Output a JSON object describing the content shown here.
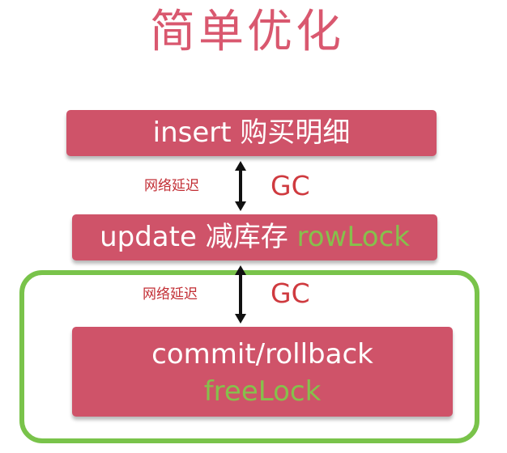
{
  "title": "简单优化",
  "steps": {
    "insert": {
      "text": "insert 购买明细"
    },
    "update": {
      "text": "update 减库存",
      "lock": "rowLock"
    },
    "commit": {
      "text": "commit/rollback",
      "lock": "freeLock"
    }
  },
  "gaps": [
    {
      "label": "网络延迟",
      "gc": "GC"
    },
    {
      "label": "网络延迟",
      "gc": "GC"
    }
  ],
  "colors": {
    "title": "#d9586f",
    "box": "#cf5369",
    "box_text": "#ffffff",
    "lock_text": "#86c04c",
    "frame": "#79c34a",
    "latency_text": "#c22e34",
    "gc_text": "#cf3a3f",
    "arrow": "#111111"
  }
}
